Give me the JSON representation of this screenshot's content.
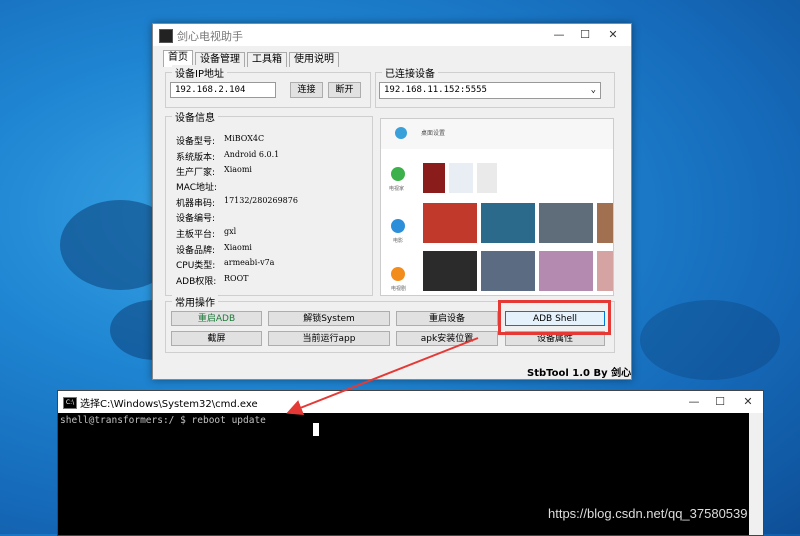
{
  "window": {
    "title": "剑心电视助手",
    "minimize": "—",
    "maximize": "☐",
    "close": "✕",
    "tabs": [
      "首页",
      "设备管理",
      "工具箱",
      "使用说明"
    ],
    "ip_group_label": "设备IP地址",
    "ip_value": "192.168.2.104",
    "connect_label": "连接",
    "disconnect_label": "断开",
    "connected_group_label": "已连接设备",
    "connected_value": "192.168.11.152:5555",
    "info_group_label": "设备信息",
    "info": [
      {
        "label": "设备型号:",
        "value": "MiBOX4C"
      },
      {
        "label": "系统版本:",
        "value": "Android 6.0.1"
      },
      {
        "label": "生产厂家:",
        "value": "Xiaomi"
      },
      {
        "label": "MAC地址:",
        "value": ""
      },
      {
        "label": "机器串码:",
        "value": "17132/280269876"
      },
      {
        "label": "设备编号:",
        "value": ""
      },
      {
        "label": "主板平台:",
        "value": "gxl"
      },
      {
        "label": "设备品牌:",
        "value": "Xiaomi"
      },
      {
        "label": "CPU类型:",
        "value": "armeabi-v7a"
      },
      {
        "label": "ADB权限:",
        "value": "ROOT"
      }
    ],
    "ops_group_label": "常用操作",
    "ops": [
      "重启ADB",
      "解锁System",
      "重启设备",
      "ADB Shell",
      "截屏",
      "当前运行app",
      "apk安装位置",
      "设备属性"
    ],
    "footer": "StbTool 1.0  By 剑心",
    "preview_left_labels": [
      "电视家",
      "电影",
      "电视剧"
    ],
    "preview_header": "桌面设置"
  },
  "cmd": {
    "title": "选择C:\\Windows\\System32\\cmd.exe",
    "line": "shell@transformers:/ $ reboot update",
    "minimize": "—",
    "maximize": "☐",
    "close": "✕"
  },
  "watermark": "https://blog.csdn.net/qq_37580539",
  "colors": {
    "highlight": "#e53935",
    "desktop": "#1f86d3"
  }
}
